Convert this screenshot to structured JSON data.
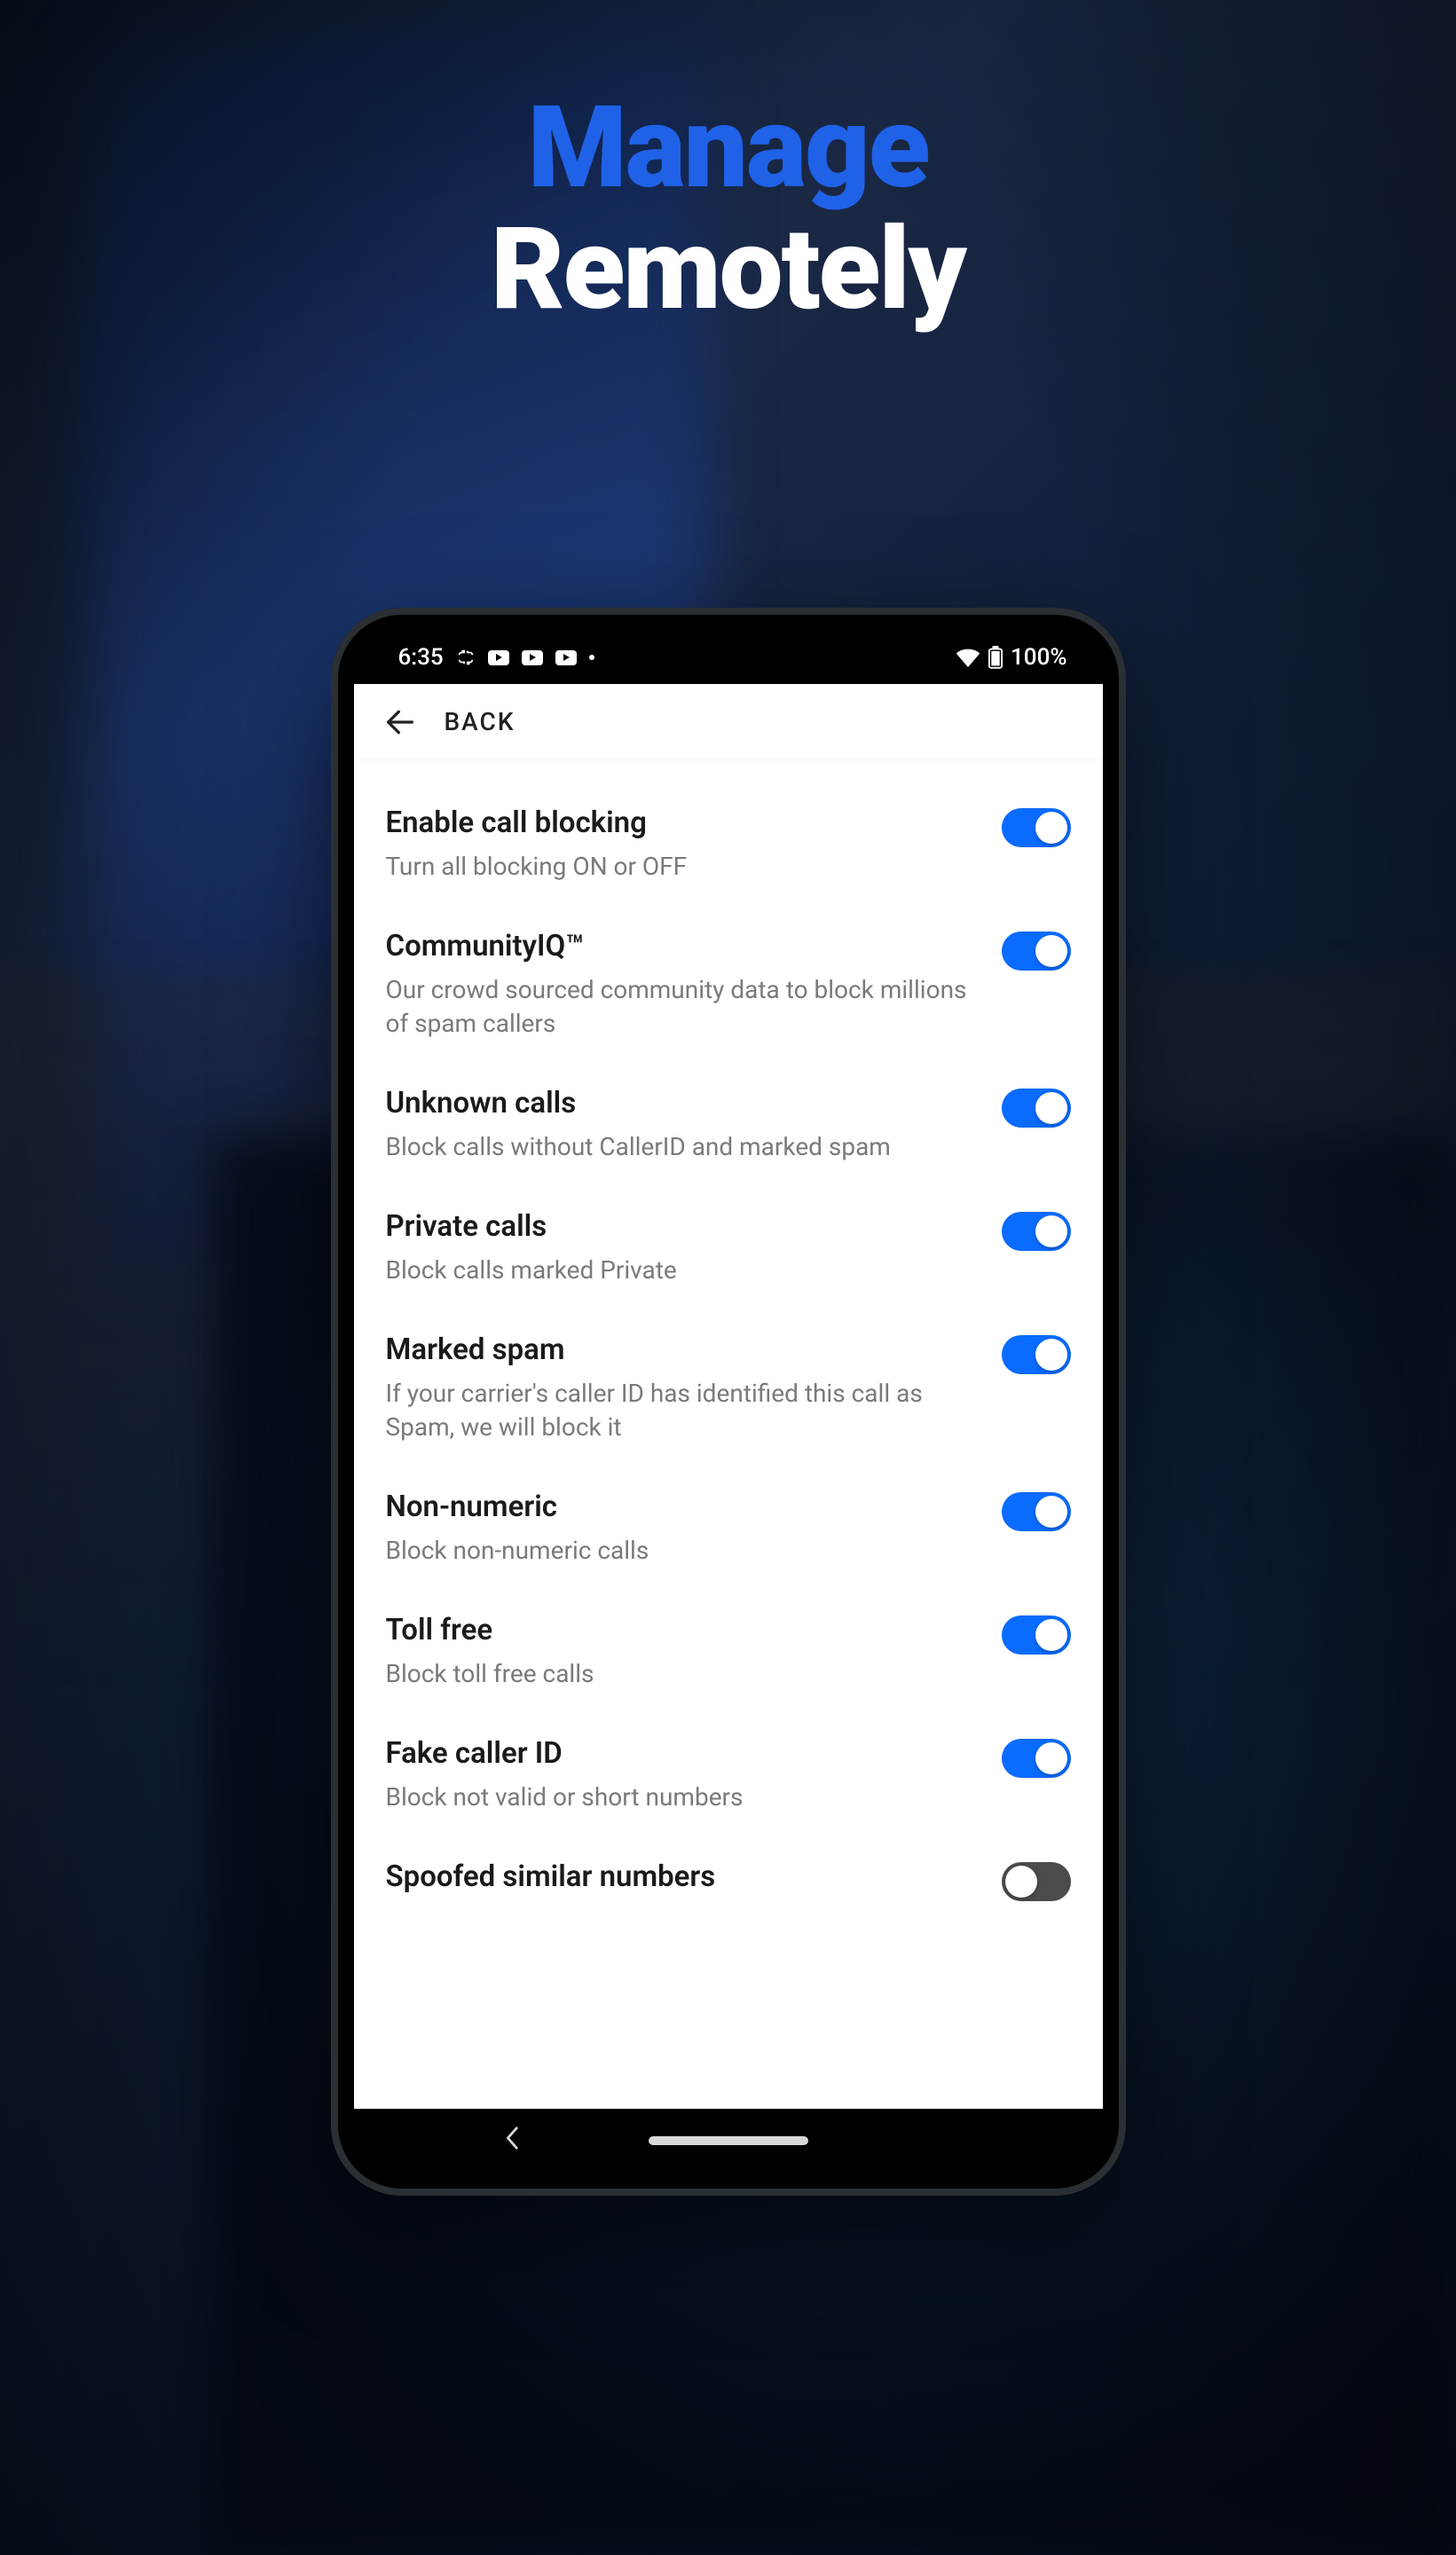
{
  "hero": {
    "line1": "Manage",
    "line2": "Remotely"
  },
  "status_bar": {
    "time": "6:35",
    "battery_text": "100%"
  },
  "header": {
    "back_label": "BACK"
  },
  "settings": [
    {
      "key": "enable-call-blocking",
      "title": "Enable call blocking",
      "desc": "Turn all blocking ON or OFF",
      "on": true
    },
    {
      "key": "community-iq",
      "title": "CommunityIQ™",
      "desc": "Our crowd sourced community data to block millions of spam callers",
      "on": true
    },
    {
      "key": "unknown-calls",
      "title": "Unknown calls",
      "desc": "Block calls without CallerID and marked spam",
      "on": true
    },
    {
      "key": "private-calls",
      "title": "Private calls",
      "desc": "Block calls marked Private",
      "on": true
    },
    {
      "key": "marked-spam",
      "title": "Marked spam",
      "desc": "If your carrier's caller ID has identified this call as Spam, we will block it",
      "on": true
    },
    {
      "key": "non-numeric",
      "title": "Non-numeric",
      "desc": "Block non-numeric calls",
      "on": true
    },
    {
      "key": "toll-free",
      "title": "Toll free",
      "desc": "Block toll free calls",
      "on": true
    },
    {
      "key": "fake-caller-id",
      "title": "Fake caller ID",
      "desc": "Block not valid or short numbers",
      "on": true
    },
    {
      "key": "spoofed-similar",
      "title": "Spoofed similar numbers",
      "desc": "",
      "on": false
    }
  ]
}
